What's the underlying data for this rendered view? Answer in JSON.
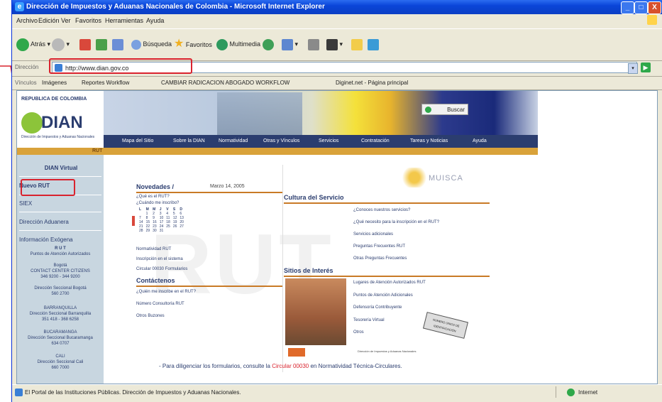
{
  "window": {
    "title": "Dirección de Impuestos y Aduanas Nacionales de Colombia - Microsoft Internet Explorer",
    "minimize": "_",
    "maximize": "□",
    "close": "X"
  },
  "menu": [
    "Archivo",
    "Edición",
    "Ver",
    "Favoritos",
    "Herramientas",
    "Ayuda"
  ],
  "toolbar": {
    "back": "Atrás",
    "search": "Búsqueda",
    "favorites": "Favoritos",
    "multimedia": "Multimedia"
  },
  "address": {
    "label": "Dirección",
    "value": "http://www.dian.gov.co"
  },
  "links": {
    "label": "Vínculos",
    "items": [
      "Imágenes",
      "Reportes Workflow",
      "CAMBIAR RADICACION ABOGADO WORKFLOW",
      "Diginet.net - Página principal"
    ]
  },
  "site": {
    "country": "REPUBLICA DE COLOMBIA",
    "logo": "DIAN",
    "logo_sub": "Dirección de Impuestos y Aduanas Nacionales",
    "rut_tag": "RUT",
    "search_button": "Buscar",
    "nav": [
      "Mapa del Sitio",
      "Sobre la DIAN",
      "Normatividad",
      "Otras y Vínculos",
      "Servicios",
      "Contratación",
      "Tareas y Noticias",
      "Ayuda"
    ],
    "watermark": "RUT",
    "muisca": "MUISCA"
  },
  "sidebar": {
    "items": [
      "DIAN Virtual",
      "Nuevo RUT",
      "SIEX",
      "Dirección Aduanera",
      "Información Exógena"
    ],
    "info": [
      {
        "title": "R U T",
        "lines": [
          "Puntos de Atención Autorizados"
        ]
      },
      {
        "title": "Bogotá",
        "lines": [
          "CONTACT CENTER CITIZENS",
          "346 9200 - 344 9200"
        ]
      },
      {
        "title": "Dirección Seccional Bogotá",
        "lines": [
          "560 2700"
        ]
      },
      {
        "title": "BARRANQUILLA",
        "lines": [
          "Dirección Seccional Barranquilla",
          "351 418 - 368 6258"
        ]
      },
      {
        "title": "BUCARAMANGA",
        "lines": [
          "Dirección Seccional Bucaramanga",
          "634 0707"
        ]
      },
      {
        "title": "CALI",
        "lines": [
          "Dirección Seccional Cali",
          "660 7000"
        ]
      }
    ]
  },
  "novedades": {
    "title": "Novedades /",
    "date": "Marzo 14, 2005",
    "links": [
      "¿Qué es el RUT?",
      "¿Cuándo me inscribo?"
    ],
    "more": [
      "Normatividad RUT",
      "Inscripción en el sistema",
      "Circular 00030 Formularios"
    ]
  },
  "calendar": {
    "rows": [
      [
        "L",
        "M",
        "M",
        "J",
        "V",
        "S",
        "D"
      ],
      [
        "",
        "1",
        "2",
        "3",
        "4",
        "5",
        "6"
      ],
      [
        "7",
        "8",
        "9",
        "10",
        "11",
        "12",
        "13"
      ],
      [
        "14",
        "15",
        "16",
        "17",
        "18",
        "19",
        "20"
      ],
      [
        "21",
        "22",
        "23",
        "24",
        "25",
        "26",
        "27"
      ],
      [
        "28",
        "29",
        "30",
        "31",
        "",
        "",
        ""
      ]
    ]
  },
  "contactenos": {
    "title": "Contáctenos",
    "links": [
      "¿Quién me inscribe en el RUT?",
      "Número Consultoría RUT",
      "Otros Buzones"
    ]
  },
  "cultura": {
    "title": "Cultura del Servicio",
    "links": [
      "¿Conoces nuestros servicios?",
      "¿Qué necesito para la inscripción en el RUT?",
      "Servicios adicionales",
      "Preguntas Frecuentes RUT",
      "Otras Preguntas Frecuentes"
    ]
  },
  "sitios": {
    "title": "Sitios de Interés",
    "links": [
      "Lugares de Atención Autorizados RUT",
      "Puntos de Atención Adicionales",
      "Defensoría Contribuyente",
      "Tesorería Virtual",
      "Otros"
    ],
    "stamp": "NÚMERO ÚNICO DE IDENTIFICACIÓN",
    "footer_link": "Dirección de Impuestos y Aduanas Nacionales"
  },
  "footer": {
    "pre": "- Para diligenciar los formularios, consulte la",
    "link": "Circular 00030",
    "post": "en Normatividad Técnica-Circulares."
  },
  "status": {
    "text": "El Portal de las Instituciones Públicas. Dirección de Impuestos y Aduanas Nacionales.",
    "zone": "Internet"
  },
  "colors": {
    "xp_blue": "#0a45d8",
    "nav_dark": "#2b3d6f",
    "accent_orange": "#d9a23a",
    "highlight_red": "#d9232e",
    "dian_green": "#8cc43a"
  }
}
